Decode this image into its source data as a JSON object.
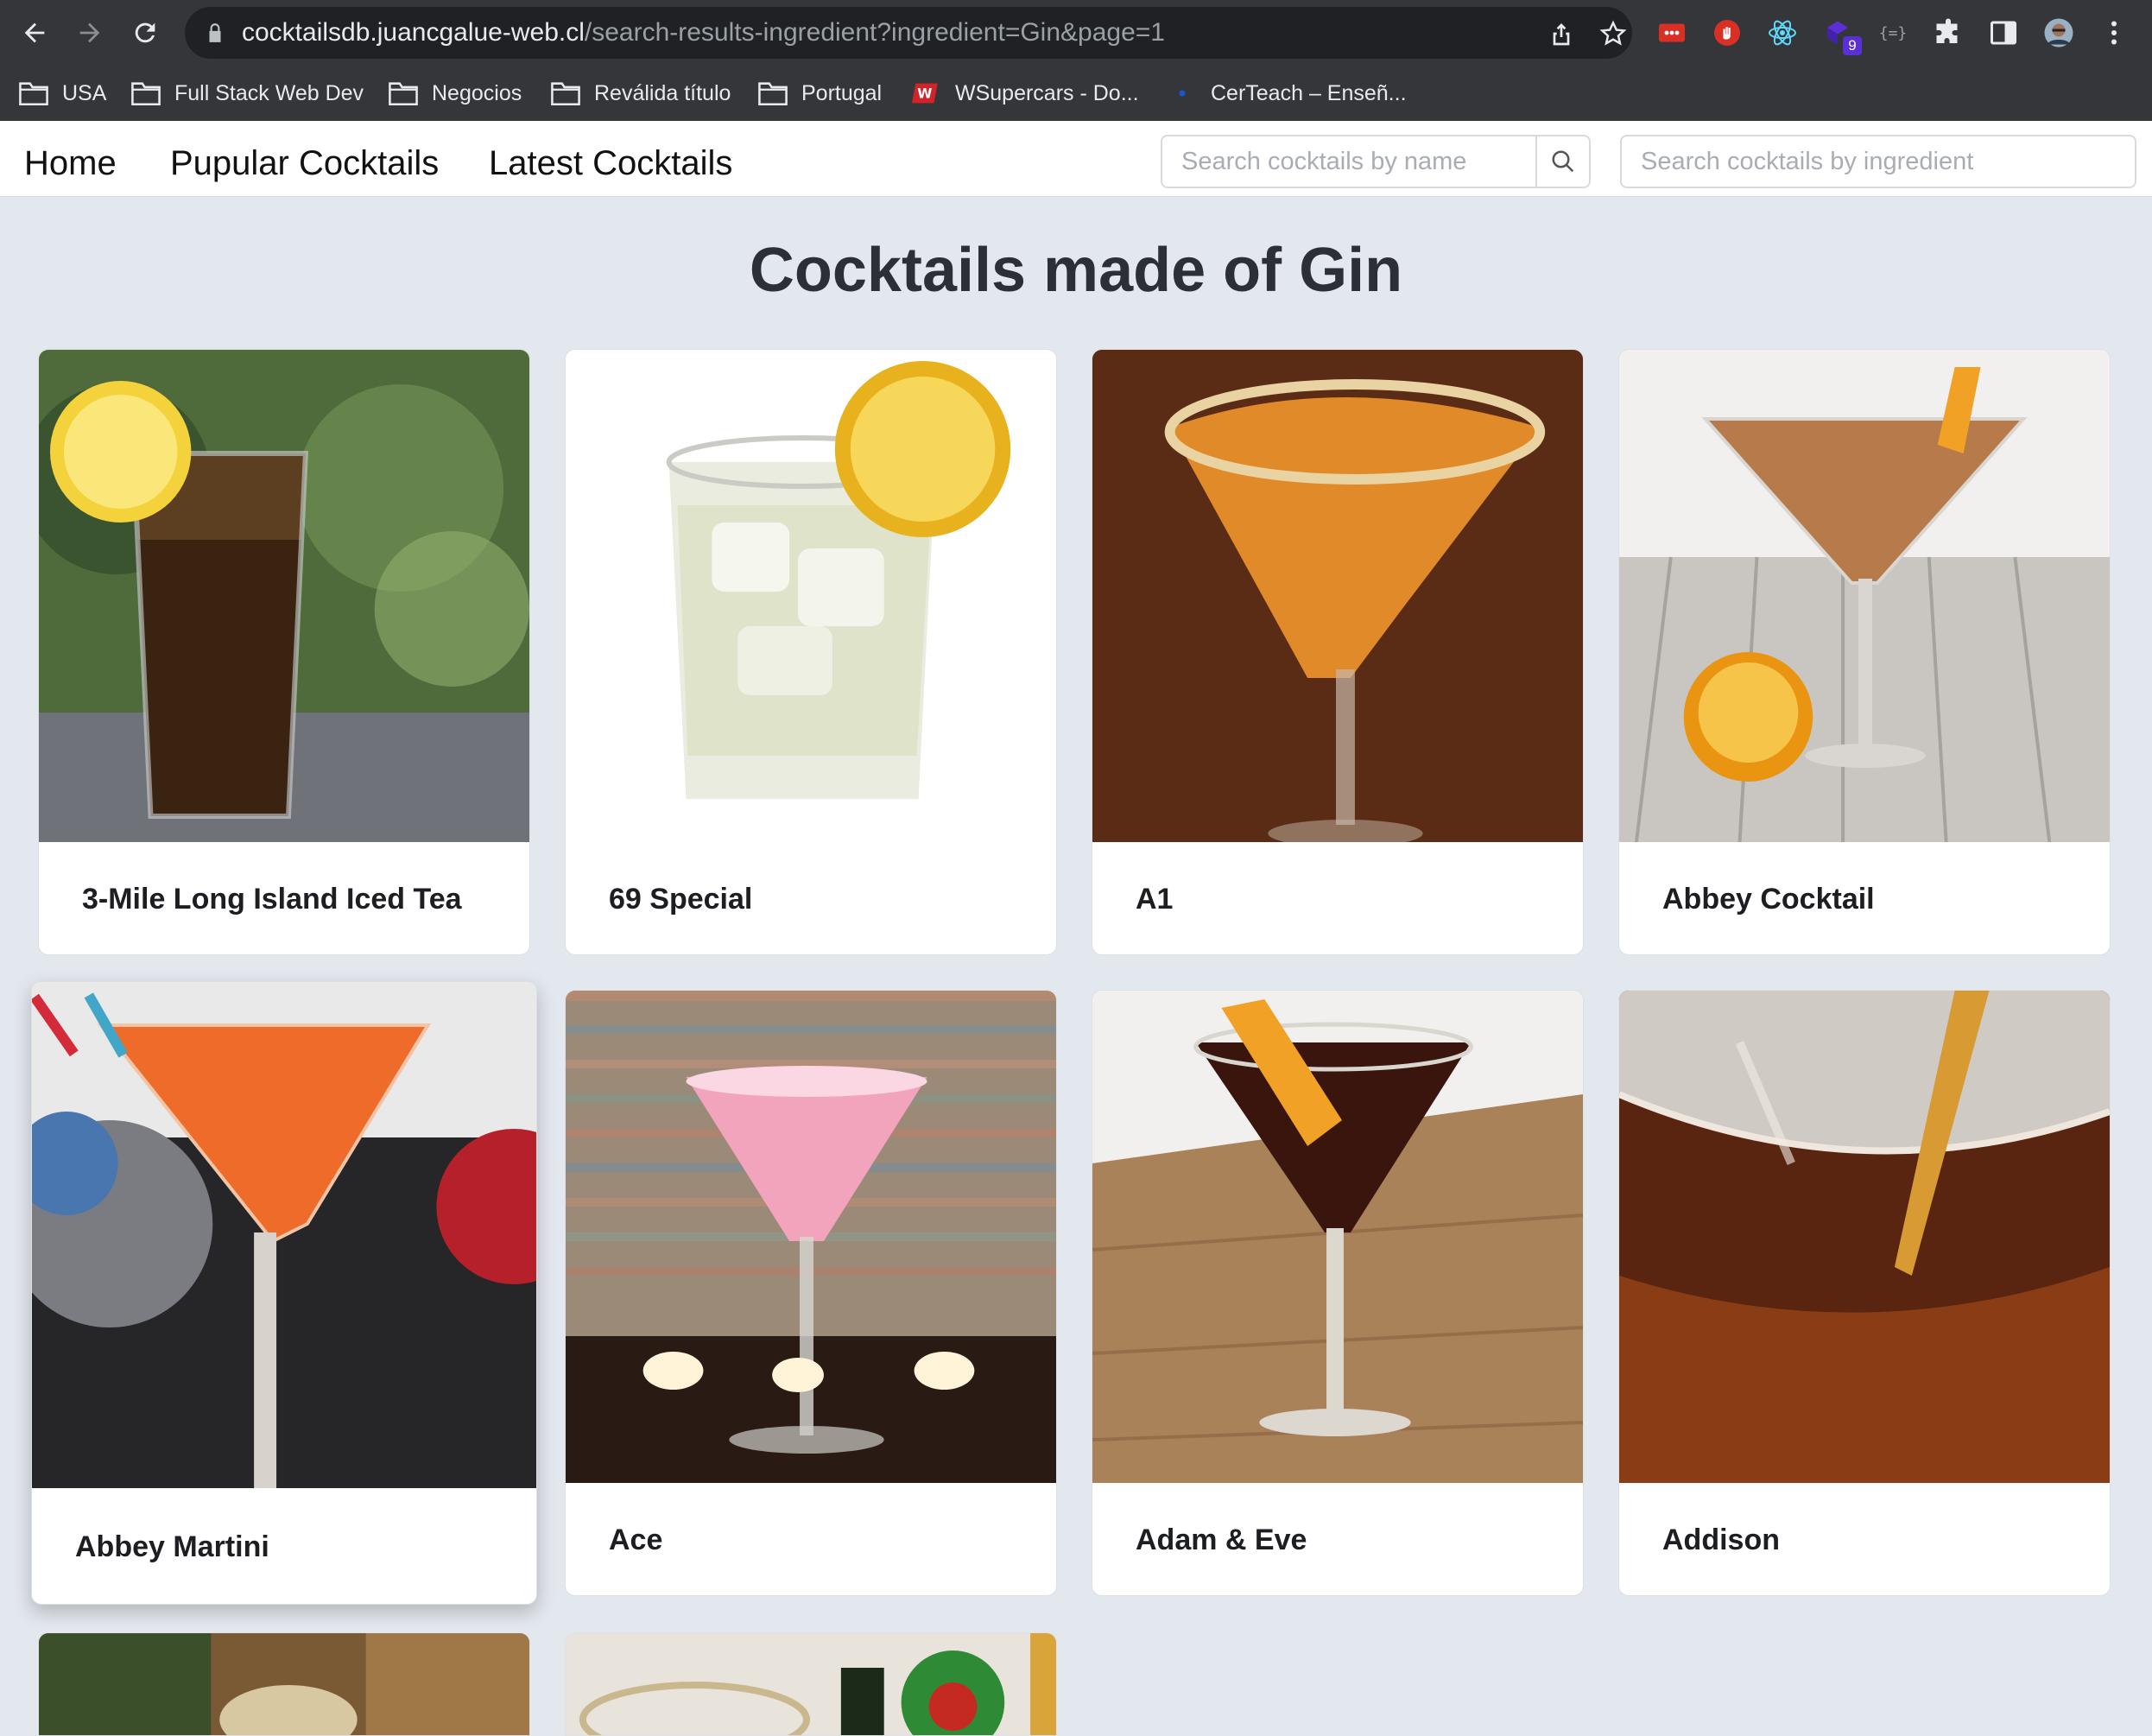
{
  "browser": {
    "url_host": "cocktailsdb.juancgalue-web.cl",
    "url_path": "/search-results-ingredient?ingredient=Gin&page=1",
    "extension_badge": "9",
    "bookmarks": [
      {
        "label": "USA",
        "icon": "folder-icon"
      },
      {
        "label": "Full Stack Web Dev",
        "icon": "folder-icon"
      },
      {
        "label": "Negocios",
        "icon": "folder-icon"
      },
      {
        "label": "Reválida título",
        "icon": "folder-icon"
      },
      {
        "label": "Portugal",
        "icon": "folder-icon"
      },
      {
        "label": "WSupercars - Do...",
        "icon": "wsupercars-favicon"
      },
      {
        "label": "CerTeach – Enseñ...",
        "icon": "certeach-favicon"
      }
    ]
  },
  "nav": {
    "links": [
      "Home",
      "Pupular Cocktails",
      "Latest Cocktails"
    ],
    "search_name_placeholder": "Search cocktails by name",
    "search_ingredient_placeholder": "Search cocktails by ingredient"
  },
  "main": {
    "title": "Cocktails made of Gin",
    "cocktails": [
      {
        "name": "3-Mile Long Island Iced Tea"
      },
      {
        "name": "69 Special"
      },
      {
        "name": "A1"
      },
      {
        "name": "Abbey Cocktail"
      },
      {
        "name": "Abbey Martini"
      },
      {
        "name": "Ace"
      },
      {
        "name": "Adam & Eve"
      },
      {
        "name": "Addison"
      }
    ]
  },
  "colors": {
    "page_background": "#e3e7ee",
    "chrome": "#35363a",
    "title_text": "#2d2f36"
  }
}
